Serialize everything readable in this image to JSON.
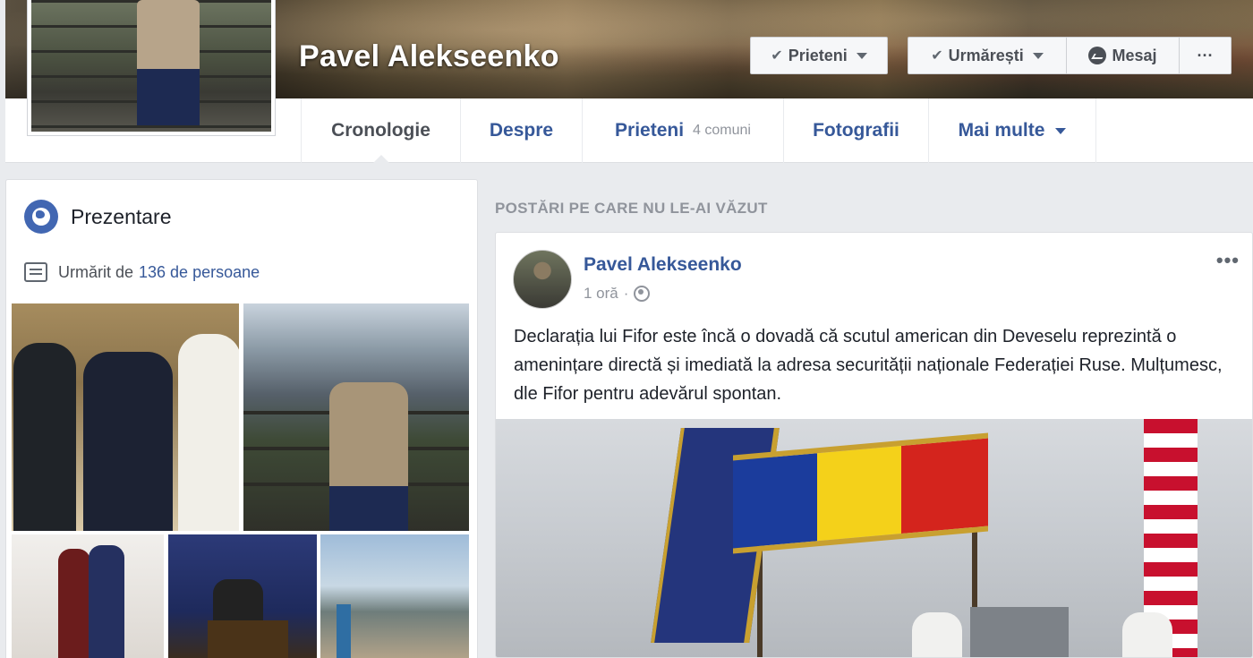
{
  "profile": {
    "name": "Pavel Alekseenko"
  },
  "cover_actions": {
    "friends_label": "Prieteni",
    "follow_label": "Urmărești",
    "message_label": "Mesaj",
    "more_label": "···"
  },
  "nav": {
    "tabs": [
      {
        "label": "Cronologie",
        "sub": ""
      },
      {
        "label": "Despre",
        "sub": ""
      },
      {
        "label": "Prieteni",
        "sub": "4 comuni"
      },
      {
        "label": "Fotografii",
        "sub": ""
      },
      {
        "label": "Mai multe",
        "sub": ""
      }
    ]
  },
  "intro": {
    "title": "Prezentare",
    "followed_prefix": "Urmărit de",
    "followed_link": "136 de persoane"
  },
  "feed": {
    "section_label": "POSTĂRI PE CARE NU LE-AI VĂZUT",
    "post": {
      "author": "Pavel Alekseenko",
      "time": "1 oră",
      "separator": "·",
      "options": "•••",
      "text": "Declarația lui Fifor este încă o dovadă că scutul american din Deveselu reprezintă o amenințare directă și imediată la adresa securității naționale Federației Ruse. Mulțumesc, dle Fifor pentru adevărul spontan."
    }
  },
  "colors": {
    "link_blue": "#365899",
    "brand_blue": "#4267b2",
    "page_bg": "#e9ebee",
    "muted_text": "#90949c"
  },
  "icons": {
    "intro": "globe-icon",
    "followed": "rss-icon",
    "privacy": "public-globe-icon",
    "message": "messenger-icon"
  }
}
